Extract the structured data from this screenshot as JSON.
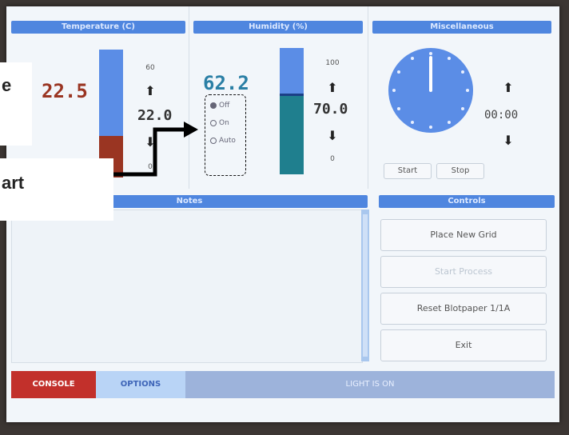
{
  "panels": {
    "temperature": {
      "header": "Temperature (C)",
      "current": "22.5",
      "setpoint": "22.0",
      "scale_top": "60",
      "scale_bottom": "0"
    },
    "humidity": {
      "header": "Humidity (%)",
      "current": "62.2",
      "setpoint": "70.0",
      "scale_top": "100",
      "scale_bottom": "0",
      "mode_options": [
        "Off",
        "On",
        "Auto"
      ]
    },
    "misc": {
      "header": "Miscellaneous",
      "timer": "00:00",
      "start_label": "Start",
      "stop_label": "Stop"
    }
  },
  "notes": {
    "header": "Notes"
  },
  "controls": {
    "header": "Controls",
    "buttons": [
      "Place New Grid",
      "Start Process",
      "Reset Blotpaper 1/1A",
      "Exit"
    ]
  },
  "bottom_bar": {
    "console_label": "CONSOLE",
    "options_label": "OPTIONS",
    "status_text": "LIGHT IS ON"
  },
  "callouts": {
    "top_text": "e",
    "bottom_text": "art"
  },
  "colors": {
    "header_blue": "#4f86df",
    "temp_red": "#9a3522",
    "humidity_teal": "#1f7f8e",
    "clock_blue": "#5b8de6",
    "console_red": "#c2302b"
  }
}
